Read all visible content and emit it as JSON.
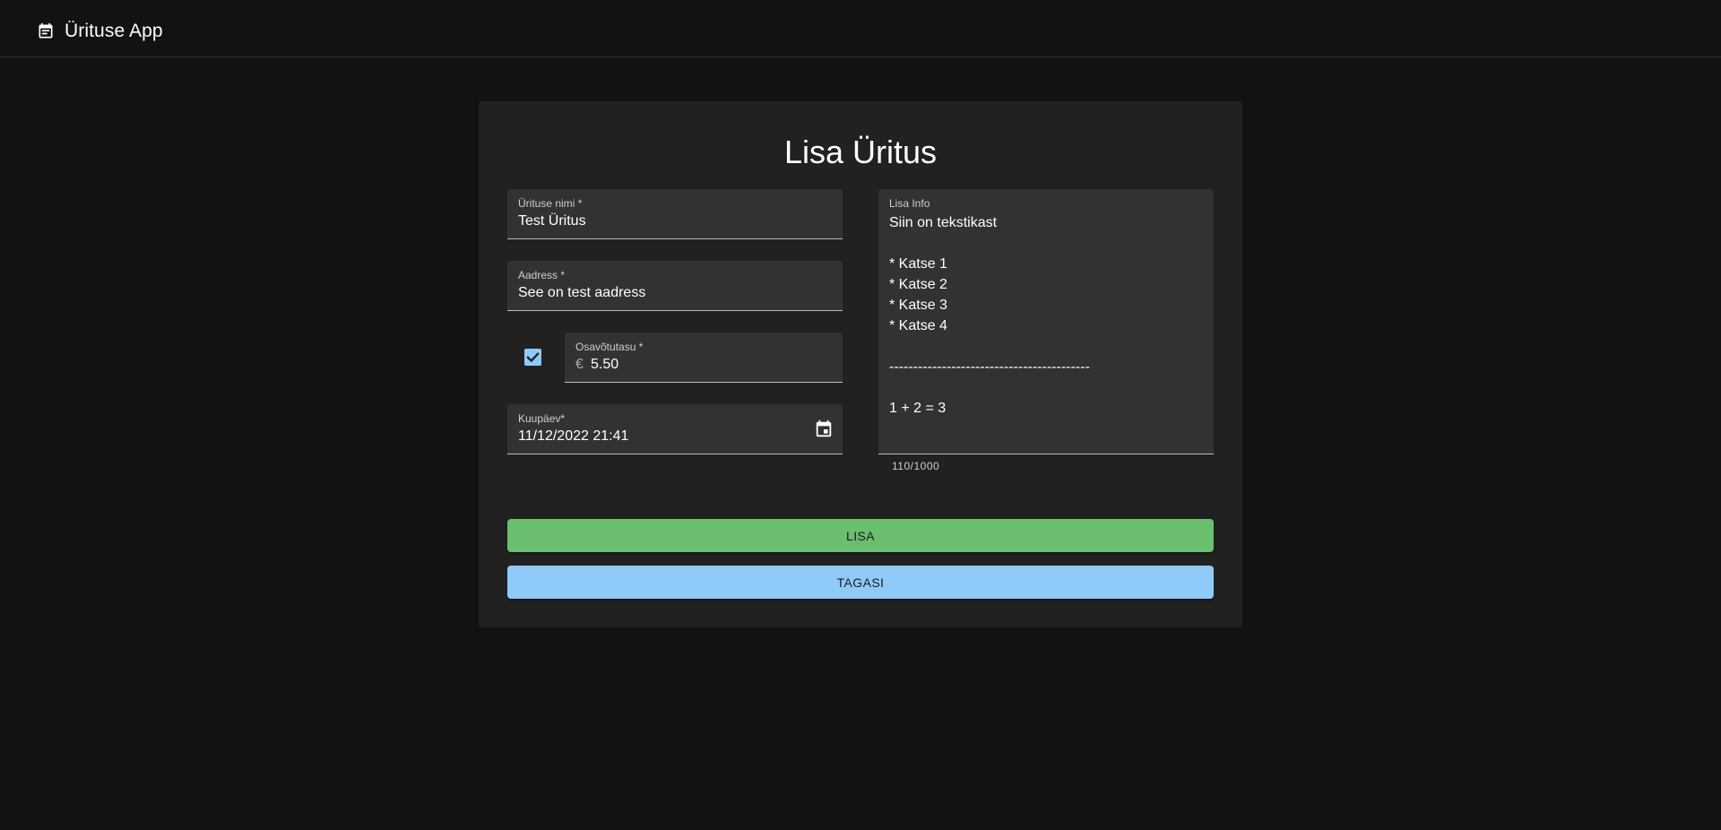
{
  "app": {
    "title": "Ürituse App",
    "icon": "event-note-icon"
  },
  "form": {
    "title": "Lisa Üritus",
    "name_field": {
      "label": "Ürituse nimi *",
      "value": "Test Üritus"
    },
    "address_field": {
      "label": "Aadress *",
      "value": "See on test aadress"
    },
    "fee_field": {
      "label": "Osavõtutasu *",
      "prefix": "€",
      "value": "5.50",
      "checked": true
    },
    "date_field": {
      "label": "Kuupäev*",
      "value": "11/12/2022 21:41",
      "icon": "calendar-icon"
    },
    "info_field": {
      "label": "Lisa Info",
      "value": "Siin on tekstikast\n\n* Katse 1\n* Katse 2\n* Katse 3\n* Katse 4\n\n------------------------------------------\n\n1 + 2 = 3",
      "counter": "110/1000"
    },
    "buttons": {
      "submit_label": "LISA",
      "back_label": "TAGASI"
    }
  },
  "colors": {
    "background": "#121212",
    "card": "#212121",
    "field": "#323232",
    "submit_button": "#6abe6e",
    "back_button": "#90caf9",
    "checkbox": "#90caf9"
  }
}
